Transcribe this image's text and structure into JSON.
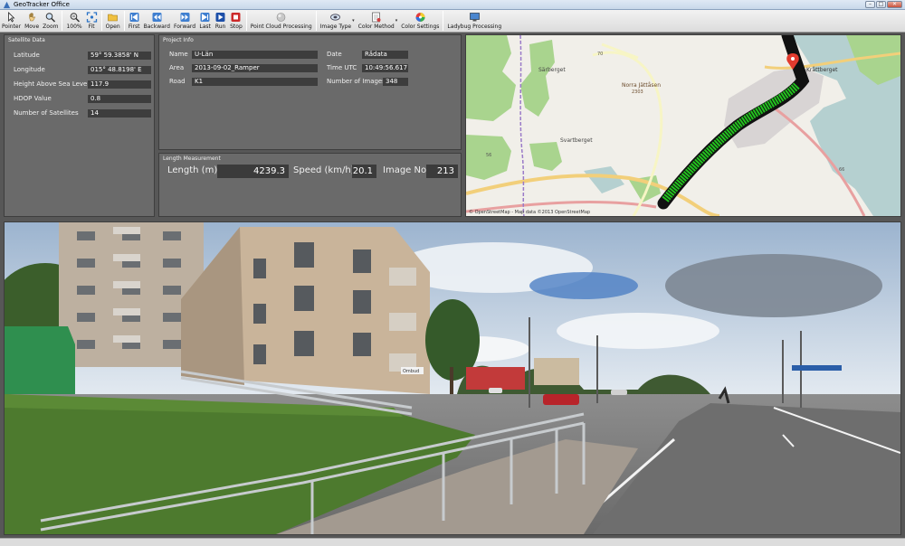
{
  "window": {
    "title": "GeoTracker Office",
    "minimize": "–",
    "maximize": "□",
    "close": "✕"
  },
  "toolbar": {
    "pointer": "Pointer",
    "move": "Move",
    "zoom": "Zoom",
    "zoom100": "100%",
    "fit": "Fit",
    "open": "Open",
    "first": "First",
    "backward": "Backward",
    "forward": "Forward",
    "last": "Last",
    "run": "Run",
    "stop": "Stop",
    "point_cloud": "Point Cloud Processing",
    "image_type": "Image Type",
    "color_method": "Color Method",
    "color_settings": "Color Settings",
    "ladybug": "Ladybug Processing"
  },
  "satellite": {
    "title": "Satellite Data",
    "latitude_label": "Latitude",
    "latitude": "59° 59.3858' N",
    "longitude_label": "Longitude",
    "longitude": "015° 48.8198' E",
    "height_label": "Height Above Sea Level",
    "height": "117.9",
    "hdop_label": "HDOP Value",
    "hdop": "0.8",
    "sats_label": "Number of Satellites",
    "sats": "14"
  },
  "project": {
    "title": "Project Info",
    "name_label": "Name",
    "name": "U-Län",
    "area_label": "Area",
    "area": "2013-09-02_Ramper",
    "road_label": "Road",
    "road": "K1",
    "date_label": "Date",
    "date": "Rådata",
    "time_label": "Time UTC",
    "time": "10:49:56.617",
    "images_label": "Number of Images",
    "images": "348"
  },
  "length": {
    "title": "Length Measurement",
    "length_label": "Length (m)",
    "length": "4239.3",
    "speed_label": "Speed (km/h)",
    "speed": "20.1",
    "image_label": "Image No",
    "image": "213"
  },
  "map": {
    "labels": {
      "sarberget": "Särberget",
      "norra": "Norra Jättåsen",
      "norra_sub": "2303",
      "svartberget": "Svartberget",
      "kratberg": "Kråttberget",
      "road56": "56",
      "road70": "70",
      "road66": "66"
    },
    "attribution": "© OpenStreetMap - Map data ©2013 OpenStreetMap",
    "colors": {
      "track": "#22c21e",
      "track_edge": "#111111",
      "marker": "#e23b2e",
      "forest": "#a9d48e",
      "water": "#b5d0d0",
      "road": "#e8a0a0"
    }
  },
  "photo": {
    "sign": "Ombud"
  }
}
